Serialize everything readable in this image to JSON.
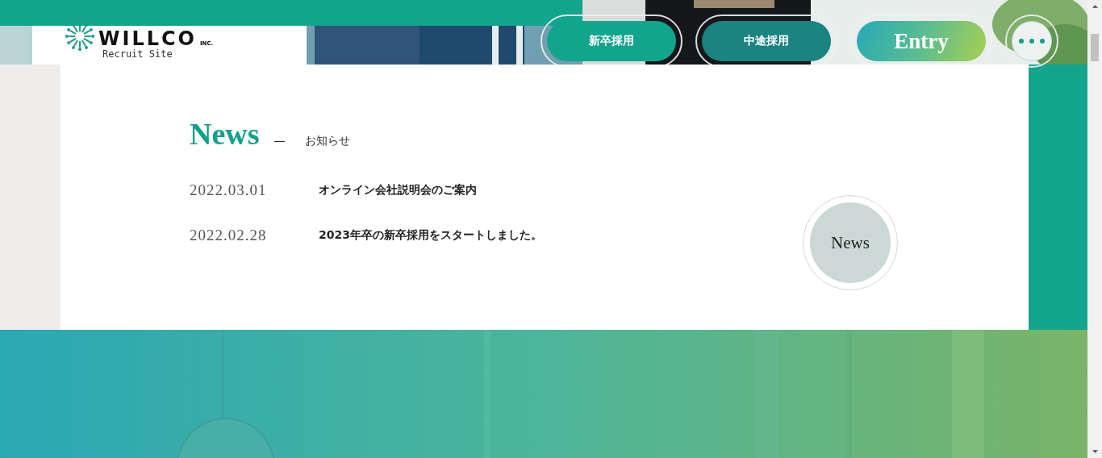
{
  "header": {
    "logo": {
      "name": "WILLCO",
      "suffix": "INC.",
      "subtitle": "Recruit Site"
    },
    "nav": [
      {
        "kind": "new",
        "label": "新卒採用"
      },
      {
        "kind": "career",
        "label": "中途採用"
      },
      {
        "kind": "entry",
        "label": "Entry"
      },
      {
        "kind": "menu"
      }
    ]
  },
  "news": {
    "title": "News",
    "dash": "—",
    "subtitle": "お知らせ",
    "items": [
      {
        "date": "2022.03.01",
        "title": "オンライン会社説明会のご案内"
      },
      {
        "date": "2022.02.28",
        "title": "2023年卒の新卒採用をスタートしました。"
      }
    ],
    "more_button": "News"
  }
}
